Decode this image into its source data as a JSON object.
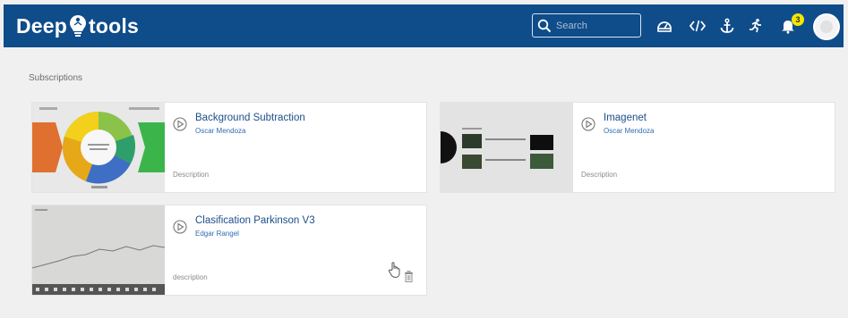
{
  "app": {
    "brand_left": "Deep",
    "brand_right": "tools"
  },
  "navbar": {
    "search_placeholder": "Search",
    "notification_count": "3",
    "icons": [
      "search-icon",
      "dashboard-icon",
      "code-icon",
      "anchor-icon",
      "run-icon",
      "bell-icon",
      "avatar"
    ]
  },
  "page": {
    "section_title": "Subscriptions"
  },
  "cards": [
    {
      "title": "Background Subtraction",
      "author": "Oscar Mendoza",
      "description": "Description"
    },
    {
      "title": "Imagenet",
      "author": "Oscar Mendoza",
      "description": "Description"
    },
    {
      "title": "Clasification Parkinson V3",
      "author": "Edgar Rangel",
      "description": "description"
    }
  ],
  "colors": {
    "navbar": "#0f4c8a",
    "badge": "#f5e600",
    "link": "#1d4e89",
    "background": "#f0f0f0"
  }
}
